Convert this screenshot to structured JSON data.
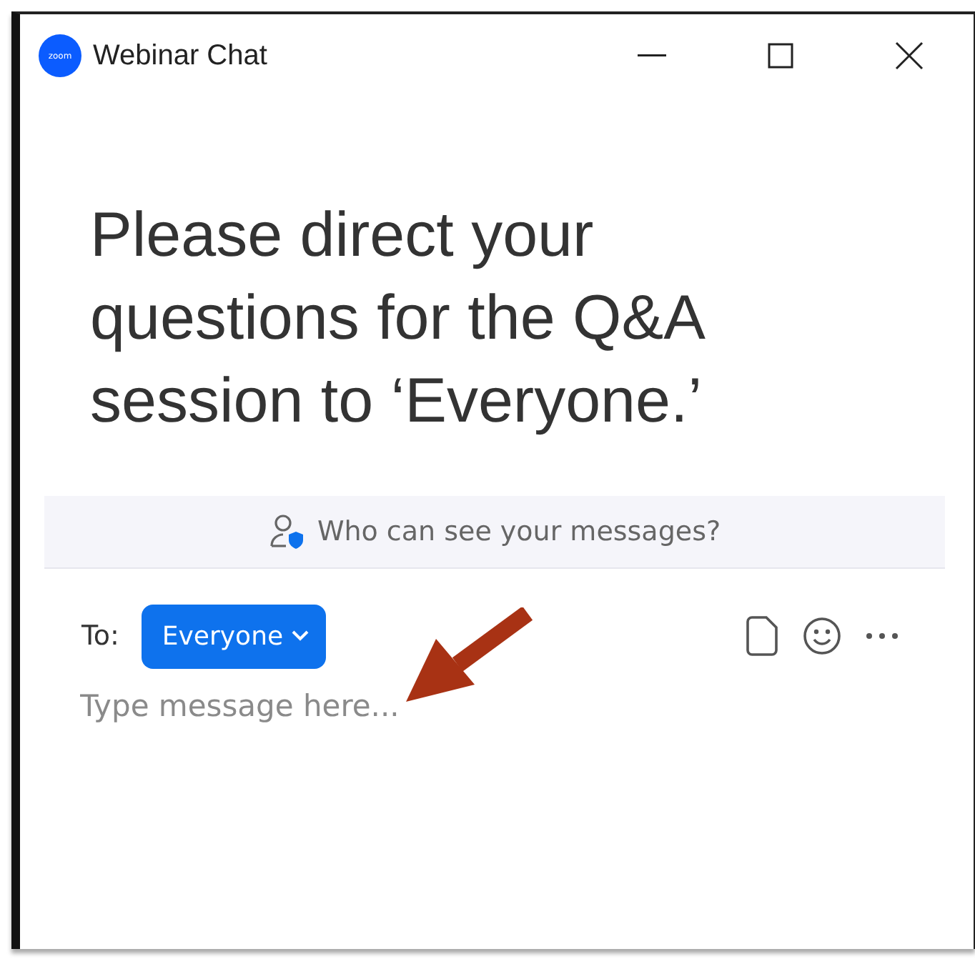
{
  "window": {
    "logo_text": "zoom",
    "title": "Webinar Chat"
  },
  "notice": "Please direct your questions for the Q&A session to ‘Everyone.’",
  "privacy_banner": "Who can see your messages?",
  "compose": {
    "to_label": "To:",
    "recipient": "Everyone",
    "placeholder": "Type message here..."
  }
}
